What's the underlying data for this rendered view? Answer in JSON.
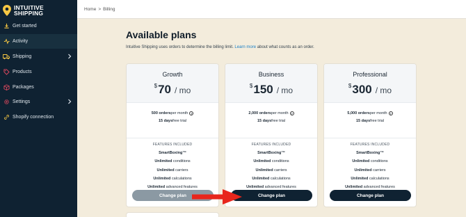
{
  "brand": {
    "name_line1": "INTUITIVE",
    "name_line2": "SHIPPING",
    "pin_color": "#f6c744"
  },
  "sidebar": {
    "items": [
      {
        "label": "Get started",
        "icon": "download-icon"
      },
      {
        "label": "Activity",
        "icon": "activity-icon",
        "active": true
      },
      {
        "label": "Shipping",
        "icon": "truck-icon",
        "has_submenu": true
      },
      {
        "label": "Products",
        "icon": "tag-icon"
      },
      {
        "label": "Packages",
        "icon": "box-icon"
      },
      {
        "label": "Settings",
        "icon": "gear-icon",
        "has_submenu": true
      },
      {
        "label": "Shopify connection",
        "icon": "link-icon"
      }
    ]
  },
  "breadcrumb": {
    "home": "Home",
    "separator": ">",
    "current": "Billing"
  },
  "page": {
    "title": "Available plans",
    "subtitle_before": "Intuitive Shipping uses orders to determine the billing limit. ",
    "subtitle_link": "Learn more",
    "subtitle_after": " about what counts as an order."
  },
  "plans": [
    {
      "name": "Growth",
      "currency": "$",
      "price": "70",
      "period": "/ mo",
      "orders_bold": "500 orders",
      "orders_rest": " per month",
      "trial_bold": "15 days",
      "trial_rest": " free trial",
      "features_heading": "FEATURES INCLUDED",
      "features": [
        {
          "bold": "SmartBoxing™",
          "rest": ""
        },
        {
          "bold": "Unlimited",
          "rest": " conditions"
        },
        {
          "bold": "Unlimited",
          "rest": " carriers"
        },
        {
          "bold": "Unlimited",
          "rest": " calculations"
        },
        {
          "bold": "Unlimited",
          "rest": " advanced features"
        }
      ],
      "button": "Change plan",
      "button_state": "disabled"
    },
    {
      "name": "Business",
      "currency": "$",
      "price": "150",
      "period": "/ mo",
      "orders_bold": "2,000 orders",
      "orders_rest": " per month",
      "trial_bold": "15 days",
      "trial_rest": " free trial",
      "features_heading": "FEATURES INCLUDED",
      "features": [
        {
          "bold": "SmartBoxing™",
          "rest": ""
        },
        {
          "bold": "Unlimited",
          "rest": " conditions"
        },
        {
          "bold": "Unlimited",
          "rest": " carriers"
        },
        {
          "bold": "Unlimited",
          "rest": " calculations"
        },
        {
          "bold": "Unlimited",
          "rest": " advanced features"
        }
      ],
      "button": "Change plan",
      "button_state": "primary"
    },
    {
      "name": "Professional",
      "currency": "$",
      "price": "300",
      "period": "/ mo",
      "orders_bold": "5,000 orders",
      "orders_rest": " per month",
      "trial_bold": "15 days",
      "trial_rest": " free trial",
      "features_heading": "FEATURES INCLUDED",
      "features": [
        {
          "bold": "SmartBoxing™",
          "rest": ""
        },
        {
          "bold": "Unlimited",
          "rest": " conditions"
        },
        {
          "bold": "Unlimited",
          "rest": " carriers"
        },
        {
          "bold": "Unlimited",
          "rest": " calculations"
        },
        {
          "bold": "Unlimited",
          "rest": " advanced features"
        }
      ],
      "button": "Change plan",
      "button_state": "primary"
    }
  ],
  "colors": {
    "sidebar_bg": "#0f2232",
    "page_bg": "#f3ecdc",
    "link": "#1a7fc6",
    "arrow": "#e8261c"
  }
}
